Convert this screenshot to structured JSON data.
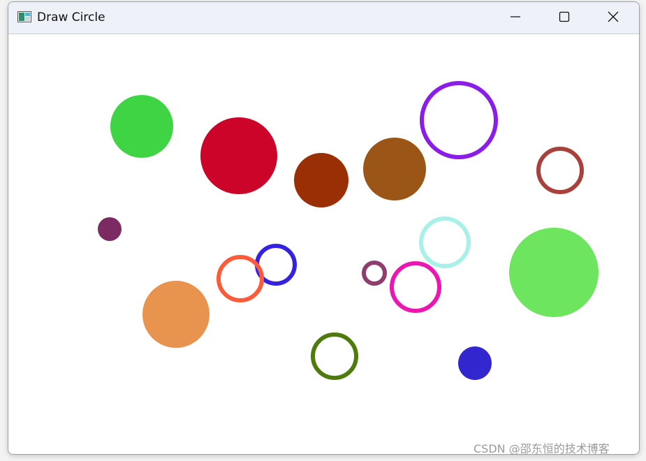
{
  "window": {
    "title": "Draw Circle",
    "app_icon": "window-app-icon",
    "controls": {
      "minimize_icon": "minimize-icon",
      "maximize_icon": "maximize-icon",
      "close_icon": "close-icon"
    }
  },
  "canvas": {
    "background": "#ffffff",
    "circles": [
      {
        "name": "green-filled-circle",
        "fill": "#3ed443",
        "filled": true
      },
      {
        "name": "red-filled-circle",
        "fill": "#cc0429",
        "filled": true
      },
      {
        "name": "dark-rust-filled-circle",
        "fill": "#9a2f06",
        "filled": true
      },
      {
        "name": "brown-filled-circle",
        "fill": "#9a5517",
        "filled": true
      },
      {
        "name": "purple-outline-circle",
        "fill": "#8b1de8",
        "filled": false
      },
      {
        "name": "maroon-outline-circle",
        "fill": "#a8413c",
        "filled": false
      },
      {
        "name": "plum-filled-dot",
        "fill": "#7b2a62",
        "filled": true
      },
      {
        "name": "cyan-outline-circle",
        "fill": "#a8f0e8",
        "filled": false
      },
      {
        "name": "light-green-filled-circle",
        "fill": "#6ee55f",
        "filled": true
      },
      {
        "name": "blue-outline-circle",
        "fill": "#3521e0",
        "filled": false
      },
      {
        "name": "orange-red-outline-circle",
        "fill": "#ff5b3b",
        "filled": false
      },
      {
        "name": "small-mauve-outline-circle",
        "fill": "#8f3d6c",
        "filled": false
      },
      {
        "name": "magenta-outline-circle",
        "fill": "#ec16b3",
        "filled": false
      },
      {
        "name": "orange-filled-circle",
        "fill": "#e8944f",
        "filled": true
      },
      {
        "name": "olive-green-outline-circle",
        "fill": "#4f7a0c",
        "filled": false
      },
      {
        "name": "blue-filled-circle",
        "fill": "#3227cf",
        "filled": true
      }
    ]
  },
  "watermark": {
    "text": "CSDN @邵东恒的技术博客"
  }
}
